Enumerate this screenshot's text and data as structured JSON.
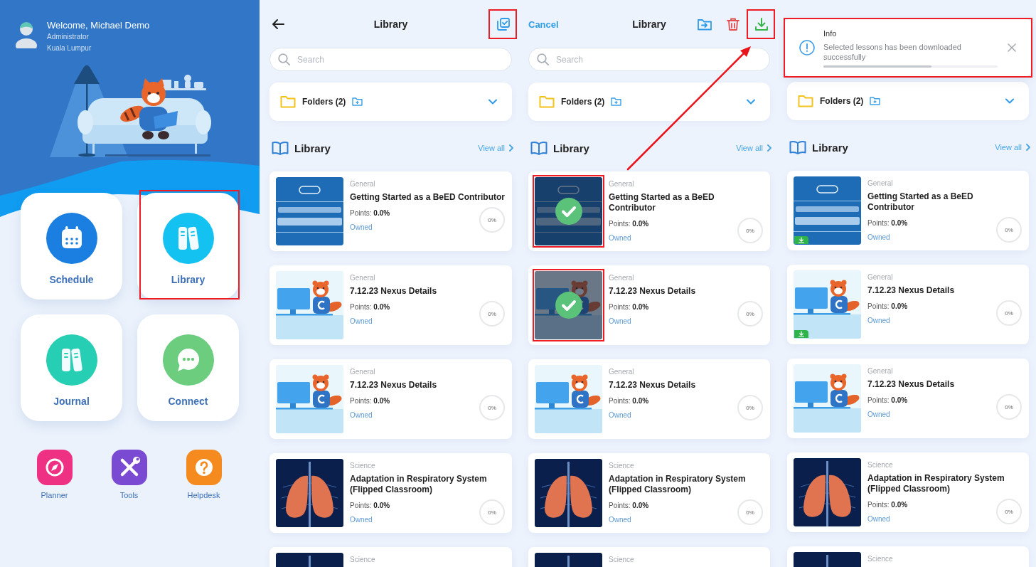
{
  "home": {
    "user": {
      "greeting": "Welcome, Michael Demo",
      "role": "Administrator",
      "location": "Kuala Lumpur"
    },
    "tiles": [
      {
        "label": "Schedule",
        "kind": "calendar",
        "color": "#1a7fe0",
        "highlighted": false
      },
      {
        "label": "Library",
        "kind": "books",
        "color": "#14c2f2",
        "highlighted": true
      },
      {
        "label": "Journal",
        "kind": "books",
        "color": "#26cfb4",
        "highlighted": false
      },
      {
        "label": "Connect",
        "kind": "chat",
        "color": "#6ccd7f",
        "highlighted": false
      }
    ],
    "shortcuts": [
      {
        "label": "Planner",
        "kind": "compass",
        "color": "#ee3183"
      },
      {
        "label": "Tools",
        "kind": "tools",
        "color": "#7a4ad2"
      },
      {
        "label": "Helpdesk",
        "kind": "help",
        "color": "#f58b1f"
      }
    ]
  },
  "library_screens": [
    {
      "header": {
        "left": {
          "kind": "back"
        },
        "title": "Library",
        "actions": [
          {
            "kind": "select",
            "highlighted": true
          }
        ]
      },
      "search": {
        "placeholder": "Search"
      },
      "folders": {
        "label": "Folders (2)"
      },
      "section": {
        "title": "Library",
        "link": "View all"
      },
      "lessons": [
        {
          "kind": "cover",
          "category": "General",
          "title": "Getting Started as a BeED Contributor",
          "points": "Points: **0.0%**",
          "status": "Owned",
          "progress": "0%"
        },
        {
          "kind": "mascot",
          "category": "General",
          "title": "7.12.23 Nexus Details",
          "points": "Points: **0.0%**",
          "status": "Owned",
          "progress": "0%"
        },
        {
          "kind": "mascot",
          "category": "General",
          "title": "7.12.23 Nexus Details",
          "points": "Points: **0.0%**",
          "status": "Owned",
          "progress": "0%"
        },
        {
          "kind": "lungs",
          "category": "Science",
          "title": "Adaptation in Respiratory System (Flipped Classroom)",
          "points": "Points: **0.0%**",
          "status": "Owned",
          "progress": "0%"
        },
        {
          "kind": "lungs",
          "category": "Science"
        }
      ]
    },
    {
      "header": {
        "left": {
          "kind": "text",
          "label": "Cancel"
        },
        "title": "Library",
        "actions": [
          {
            "kind": "move",
            "highlighted": false
          },
          {
            "kind": "delete",
            "highlighted": false
          },
          {
            "kind": "download",
            "highlighted": true
          }
        ]
      },
      "search": {
        "placeholder": "Search"
      },
      "folders": {
        "label": "Folders (2)"
      },
      "section": {
        "title": "Library",
        "link": "View all"
      },
      "annotation_arrow": true,
      "lessons": [
        {
          "kind": "cover",
          "category": "General",
          "title": "Getting Started as a BeED Contributor",
          "points": "Points: **0.0%**",
          "status": "Owned",
          "progress": "0%",
          "selected": true,
          "highlighted": true
        },
        {
          "kind": "mascot",
          "category": "General",
          "title": "7.12.23 Nexus Details",
          "points": "Points: **0.0%**",
          "status": "Owned",
          "progress": "0%",
          "selected": true,
          "highlighted": true
        },
        {
          "kind": "mascot",
          "category": "General",
          "title": "7.12.23 Nexus Details",
          "points": "Points: **0.0%**",
          "status": "Owned",
          "progress": "0%",
          "selected": false,
          "highlighted": false
        },
        {
          "kind": "lungs",
          "category": "Science",
          "title": "Adaptation in Respiratory System (Flipped Classroom)",
          "points": "Points: **0.0%**",
          "status": "Owned",
          "progress": "0%",
          "selected": false,
          "highlighted": false
        },
        {
          "kind": "lungs",
          "category": "Science",
          "selected": false,
          "highlighted": false
        }
      ]
    },
    {
      "toast": {
        "title": "Info",
        "message": "Selected lessons has been downloaded successfully",
        "level": 0.62,
        "highlighted": true
      },
      "folders": {
        "label": "Folders (2)"
      },
      "section": {
        "title": "Library",
        "link": "View all"
      },
      "lessons": [
        {
          "kind": "cover",
          "category": "General",
          "title": "Getting Started as a BeED Contributor",
          "points": "Points: **0.0%**",
          "status": "Owned",
          "progress": "0%",
          "downloaded": true
        },
        {
          "kind": "mascot",
          "category": "General",
          "title": "7.12.23 Nexus Details",
          "points": "Points: **0.0%**",
          "status": "Owned",
          "progress": "0%",
          "downloaded": true
        },
        {
          "kind": "mascot",
          "category": "General",
          "title": "7.12.23 Nexus Details",
          "points": "Points: **0.0%**",
          "status": "Owned",
          "progress": "0%",
          "downloaded": false
        },
        {
          "kind": "lungs",
          "category": "Science",
          "title": "Adaptation in Respiratory System (Flipped Classroom)",
          "points": "Points: **0.0%**",
          "status": "Owned",
          "progress": "0%",
          "downloaded": false
        },
        {
          "kind": "lungs",
          "category": "Science",
          "downloaded": false
        }
      ]
    }
  ]
}
